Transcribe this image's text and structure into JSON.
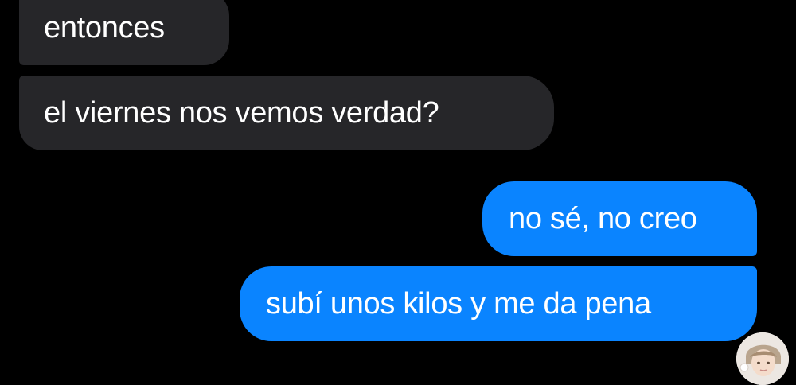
{
  "conversation": {
    "messages": [
      {
        "sender": "them",
        "text": "entonces"
      },
      {
        "sender": "them",
        "text": "el viernes nos vemos verdad?"
      },
      {
        "sender": "me",
        "text": "no sé, no creo"
      },
      {
        "sender": "me",
        "text": "subí unos kilos y me da pena"
      }
    ]
  },
  "colors": {
    "background": "#000000",
    "incoming_bubble": "#262629",
    "outgoing_bubble": "#0a84ff",
    "text": "#ffffff"
  },
  "icons": {
    "avatar": "contact-avatar-icon"
  }
}
